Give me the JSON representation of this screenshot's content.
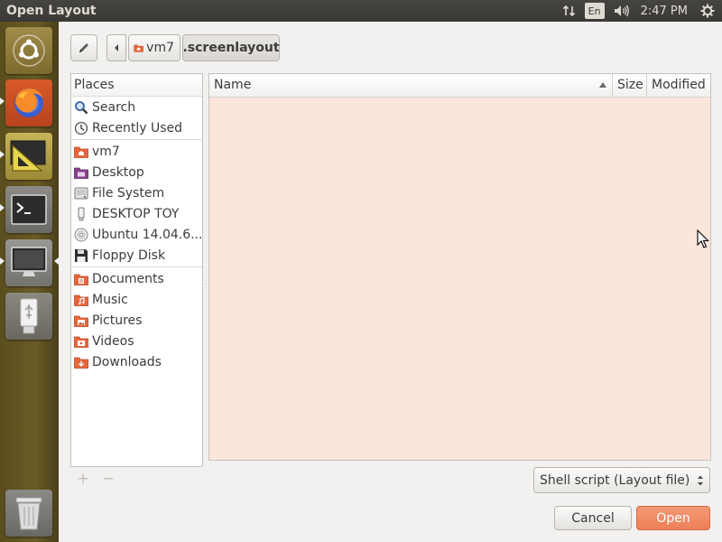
{
  "window": {
    "title": "Open Layout"
  },
  "panel": {
    "keyboard": "En",
    "time": "2:47 PM"
  },
  "launcher": {
    "items": [
      {
        "name": "dash-home",
        "icon": "ubuntu-logo-icon"
      },
      {
        "name": "firefox",
        "icon": "firefox-icon"
      },
      {
        "name": "screen-layout-editor",
        "icon": "set-square-icon"
      },
      {
        "name": "terminal",
        "icon": "terminal-icon"
      },
      {
        "name": "display",
        "icon": "monitor-icon"
      },
      {
        "name": "usb-drive",
        "icon": "usb-icon"
      },
      {
        "name": "trash",
        "icon": "trash-icon"
      }
    ]
  },
  "pathbar": {
    "home_label": "vm7",
    "current_label": ".screenlayout"
  },
  "places": {
    "header": "Places",
    "groups": [
      [
        {
          "label": "Search",
          "icon": "search-icon"
        },
        {
          "label": "Recently Used",
          "icon": "clock-icon"
        }
      ],
      [
        {
          "label": "vm7",
          "icon": "home-folder-icon"
        },
        {
          "label": "Desktop",
          "icon": "desktop-icon"
        },
        {
          "label": "File System",
          "icon": "drive-icon"
        },
        {
          "label": "DESKTOP TOY",
          "icon": "usb-stick-icon"
        },
        {
          "label": "Ubuntu 14.04.6...",
          "icon": "optical-disc-icon"
        },
        {
          "label": "Floppy Disk",
          "icon": "floppy-icon"
        }
      ],
      [
        {
          "label": "Documents",
          "icon": "documents-folder-icon"
        },
        {
          "label": "Music",
          "icon": "music-folder-icon"
        },
        {
          "label": "Pictures",
          "icon": "pictures-folder-icon"
        },
        {
          "label": "Videos",
          "icon": "videos-folder-icon"
        },
        {
          "label": "Downloads",
          "icon": "downloads-folder-icon"
        }
      ]
    ]
  },
  "files": {
    "columns": [
      "Name",
      "Size",
      "Modified"
    ],
    "rows": []
  },
  "bottom": {
    "add_symbol": "+",
    "remove_symbol": "−",
    "filter_value": "Shell script (Layout file)",
    "cancel_label": "Cancel",
    "open_label": "Open"
  },
  "colors": {
    "accent": "#ee7f58",
    "list_background": "#fce6dc",
    "panel": "#3c3b37"
  }
}
